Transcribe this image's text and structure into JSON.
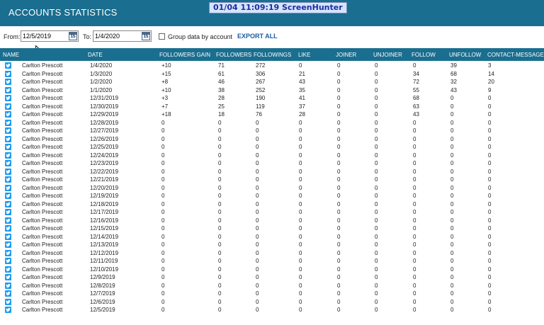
{
  "header": {
    "title": "ACCOUNTS STATISTICS",
    "overlay": "01/04  11:09:19  ScreenHunter",
    "bg_color": "#1a6e8f"
  },
  "filters": {
    "from_label": "From:",
    "from_value": "12/5/2019",
    "to_label": "To:",
    "to_value": "1/4/2020",
    "calendar_day": "15",
    "group_label": "Group data by account",
    "export_label": "EXPORT ALL"
  },
  "columns": [
    "NAME",
    "DATE",
    "FOLLOWERS GAIN",
    "FOLLOWERS",
    "FOLLOWINGS",
    "LIKE",
    "JOINER",
    "UNJOINER",
    "FOLLOW",
    "UNFOLLOW",
    "CONTACT-MESSAGE"
  ],
  "rows": [
    [
      "Carlton Prescott",
      "1/4/2020",
      "+10",
      "71",
      "272",
      "0",
      "0",
      "0",
      "0",
      "39",
      "3"
    ],
    [
      "Carlton Prescott",
      "1/3/2020",
      "+15",
      "61",
      "306",
      "21",
      "0",
      "0",
      "34",
      "68",
      "14"
    ],
    [
      "Carlton Prescott",
      "1/2/2020",
      "+8",
      "46",
      "267",
      "43",
      "0",
      "0",
      "72",
      "32",
      "20"
    ],
    [
      "Carlton Prescott",
      "1/1/2020",
      "+10",
      "38",
      "252",
      "35",
      "0",
      "0",
      "55",
      "43",
      "9"
    ],
    [
      "Carlton Prescott",
      "12/31/2019",
      "+3",
      "28",
      "190",
      "41",
      "0",
      "0",
      "68",
      "0",
      "0"
    ],
    [
      "Carlton Prescott",
      "12/30/2019",
      "+7",
      "25",
      "119",
      "37",
      "0",
      "0",
      "63",
      "0",
      "0"
    ],
    [
      "Carlton Prescott",
      "12/29/2019",
      "+18",
      "18",
      "76",
      "28",
      "0",
      "0",
      "43",
      "0",
      "0"
    ],
    [
      "Carlton Prescott",
      "12/28/2019",
      "0",
      "0",
      "0",
      "0",
      "0",
      "0",
      "0",
      "0",
      "0"
    ],
    [
      "Carlton Prescott",
      "12/27/2019",
      "0",
      "0",
      "0",
      "0",
      "0",
      "0",
      "0",
      "0",
      "0"
    ],
    [
      "Carlton Prescott",
      "12/26/2019",
      "0",
      "0",
      "0",
      "0",
      "0",
      "0",
      "0",
      "0",
      "0"
    ],
    [
      "Carlton Prescott",
      "12/25/2019",
      "0",
      "0",
      "0",
      "0",
      "0",
      "0",
      "0",
      "0",
      "0"
    ],
    [
      "Carlton Prescott",
      "12/24/2019",
      "0",
      "0",
      "0",
      "0",
      "0",
      "0",
      "0",
      "0",
      "0"
    ],
    [
      "Carlton Prescott",
      "12/23/2019",
      "0",
      "0",
      "0",
      "0",
      "0",
      "0",
      "0",
      "0",
      "0"
    ],
    [
      "Carlton Prescott",
      "12/22/2019",
      "0",
      "0",
      "0",
      "0",
      "0",
      "0",
      "0",
      "0",
      "0"
    ],
    [
      "Carlton Prescott",
      "12/21/2019",
      "0",
      "0",
      "0",
      "0",
      "0",
      "0",
      "0",
      "0",
      "0"
    ],
    [
      "Carlton Prescott",
      "12/20/2019",
      "0",
      "0",
      "0",
      "0",
      "0",
      "0",
      "0",
      "0",
      "0"
    ],
    [
      "Carlton Prescott",
      "12/19/2019",
      "0",
      "0",
      "0",
      "0",
      "0",
      "0",
      "0",
      "0",
      "0"
    ],
    [
      "Carlton Prescott",
      "12/18/2019",
      "0",
      "0",
      "0",
      "0",
      "0",
      "0",
      "0",
      "0",
      "0"
    ],
    [
      "Carlton Prescott",
      "12/17/2019",
      "0",
      "0",
      "0",
      "0",
      "0",
      "0",
      "0",
      "0",
      "0"
    ],
    [
      "Carlton Prescott",
      "12/16/2019",
      "0",
      "0",
      "0",
      "0",
      "0",
      "0",
      "0",
      "0",
      "0"
    ],
    [
      "Carlton Prescott",
      "12/15/2019",
      "0",
      "0",
      "0",
      "0",
      "0",
      "0",
      "0",
      "0",
      "0"
    ],
    [
      "Carlton Prescott",
      "12/14/2019",
      "0",
      "0",
      "0",
      "0",
      "0",
      "0",
      "0",
      "0",
      "0"
    ],
    [
      "Carlton Prescott",
      "12/13/2019",
      "0",
      "0",
      "0",
      "0",
      "0",
      "0",
      "0",
      "0",
      "0"
    ],
    [
      "Carlton Prescott",
      "12/12/2019",
      "0",
      "0",
      "0",
      "0",
      "0",
      "0",
      "0",
      "0",
      "0"
    ],
    [
      "Carlton Prescott",
      "12/11/2019",
      "0",
      "0",
      "0",
      "0",
      "0",
      "0",
      "0",
      "0",
      "0"
    ],
    [
      "Carlton Prescott",
      "12/10/2019",
      "0",
      "0",
      "0",
      "0",
      "0",
      "0",
      "0",
      "0",
      "0"
    ],
    [
      "Carlton Prescott",
      "12/9/2019",
      "0",
      "0",
      "0",
      "0",
      "0",
      "0",
      "0",
      "0",
      "0"
    ],
    [
      "Carlton Prescott",
      "12/8/2019",
      "0",
      "0",
      "0",
      "0",
      "0",
      "0",
      "0",
      "0",
      "0"
    ],
    [
      "Carlton Prescott",
      "12/7/2019",
      "0",
      "0",
      "0",
      "0",
      "0",
      "0",
      "0",
      "0",
      "0"
    ],
    [
      "Carlton Prescott",
      "12/6/2019",
      "0",
      "0",
      "0",
      "0",
      "0",
      "0",
      "0",
      "0",
      "0"
    ],
    [
      "Carlton Prescott",
      "12/5/2019",
      "0",
      "0",
      "0",
      "0",
      "0",
      "0",
      "0",
      "0",
      "0"
    ]
  ],
  "row_icon": "twitter-icon"
}
